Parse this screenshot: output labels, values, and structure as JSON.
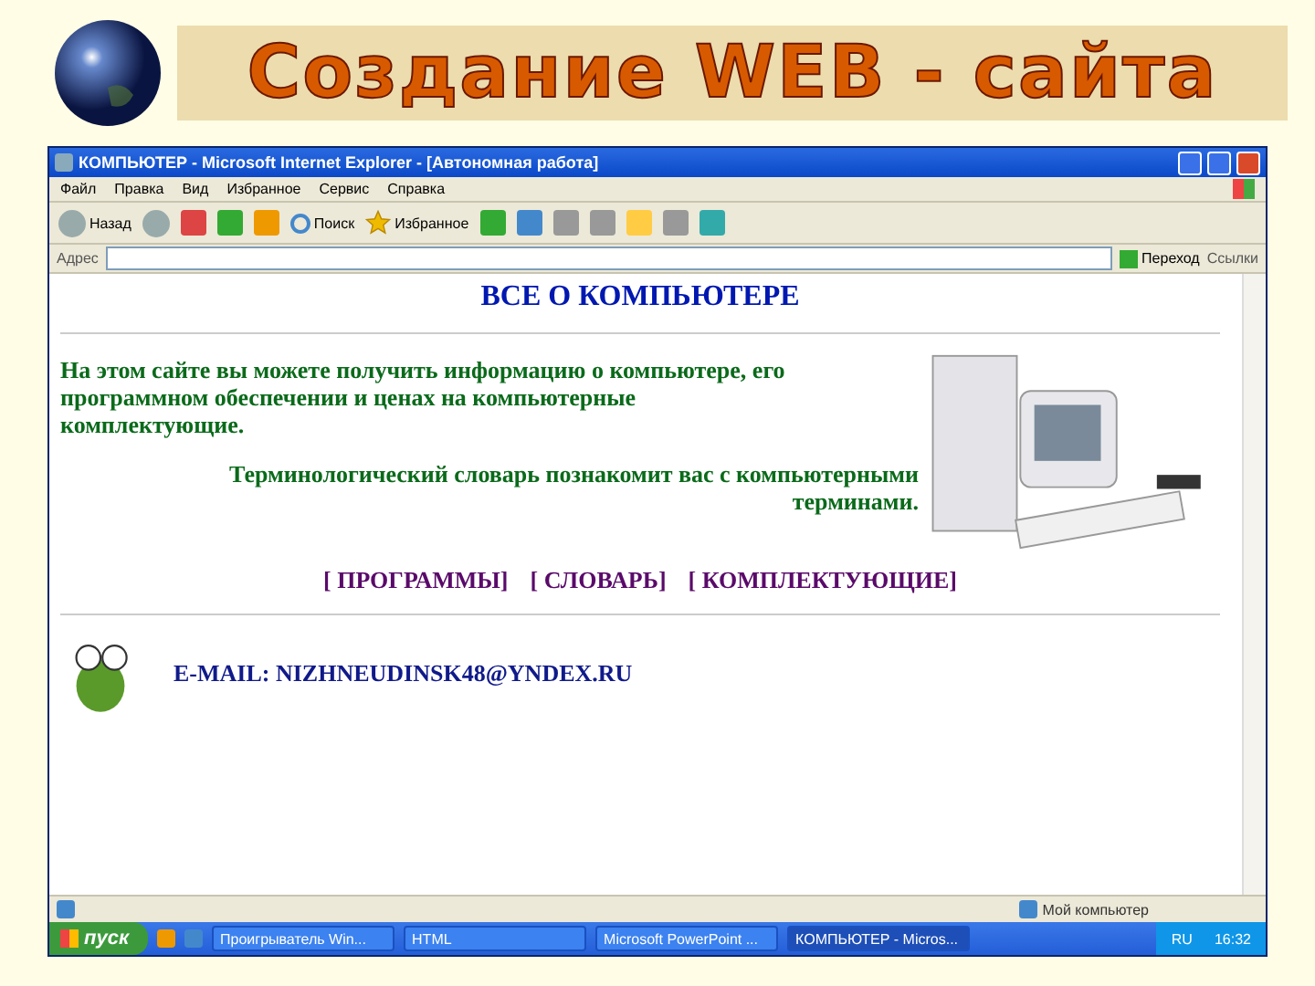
{
  "slide_title": "Создание WEB - сайта",
  "window": {
    "title": "КОМПЬЮТЕР - Microsoft Internet Explorer - [Автономная работа]"
  },
  "menu": [
    "Файл",
    "Правка",
    "Вид",
    "Избранное",
    "Сервис",
    "Справка"
  ],
  "toolbar": {
    "back": "Назад",
    "search": "Поиск",
    "favorites": "Избранное"
  },
  "address": {
    "label": "Адрес",
    "go": "Переход",
    "links": "Ссылки"
  },
  "page": {
    "heading": "ВСЕ О КОМПЬЮТЕРЕ",
    "intro": "На этом сайте вы можете получить информацию о компьютере, его программном обеспечении и ценах на компьютерные комплектующие.",
    "dictionary": "Терминологический словарь познакомит вас с компьютерными терминами.",
    "links": [
      "[ ПРОГРАММЫ]",
      "[ СЛОВАРЬ]",
      "[ КОМПЛЕКТУЮЩИЕ]"
    ],
    "email": "E-MAIL: NIZHNEUDINSK48@YNDEX.RU"
  },
  "status_bar": {
    "zone": "Мой компьютер"
  },
  "taskbar": {
    "start": "пуск",
    "tasks": [
      {
        "label": "Проигрыватель Win...",
        "selected": false
      },
      {
        "label": "HTML",
        "selected": false
      },
      {
        "label": "Microsoft PowerPoint ...",
        "selected": false
      },
      {
        "label": "КОМПЬЮТЕР - Micros...",
        "selected": true
      }
    ],
    "lang": "RU",
    "clock": "16:32"
  }
}
